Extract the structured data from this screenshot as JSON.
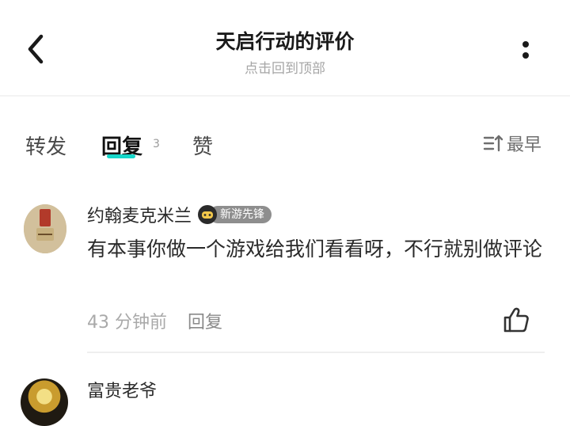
{
  "header": {
    "title": "天启行动的评价",
    "subtitle": "点击回到顶部"
  },
  "tabs": {
    "repost_label": "转发",
    "reply_label": "回复",
    "reply_count": "3",
    "like_label": "赞",
    "sort_label": "最早"
  },
  "comments": [
    {
      "author": "约翰麦克米兰",
      "badge": "新游先锋",
      "text": "有本事你做一个游戏给我们看看呀，不行就别做评论",
      "time": "43 分钟前",
      "reply_label": "回复",
      "icons": [
        "avatar-image",
        "badge-controller-icon",
        "thumbs-up-icon"
      ]
    },
    {
      "author": "富贵老爷"
    }
  ],
  "icons": [
    "back-arrow-icon",
    "more-vertical-icon",
    "sort-icon"
  ],
  "colors": {
    "accent": "#16d6c9",
    "badge_bg": "#8e8e8e",
    "muted_text": "#a9a9a9"
  }
}
